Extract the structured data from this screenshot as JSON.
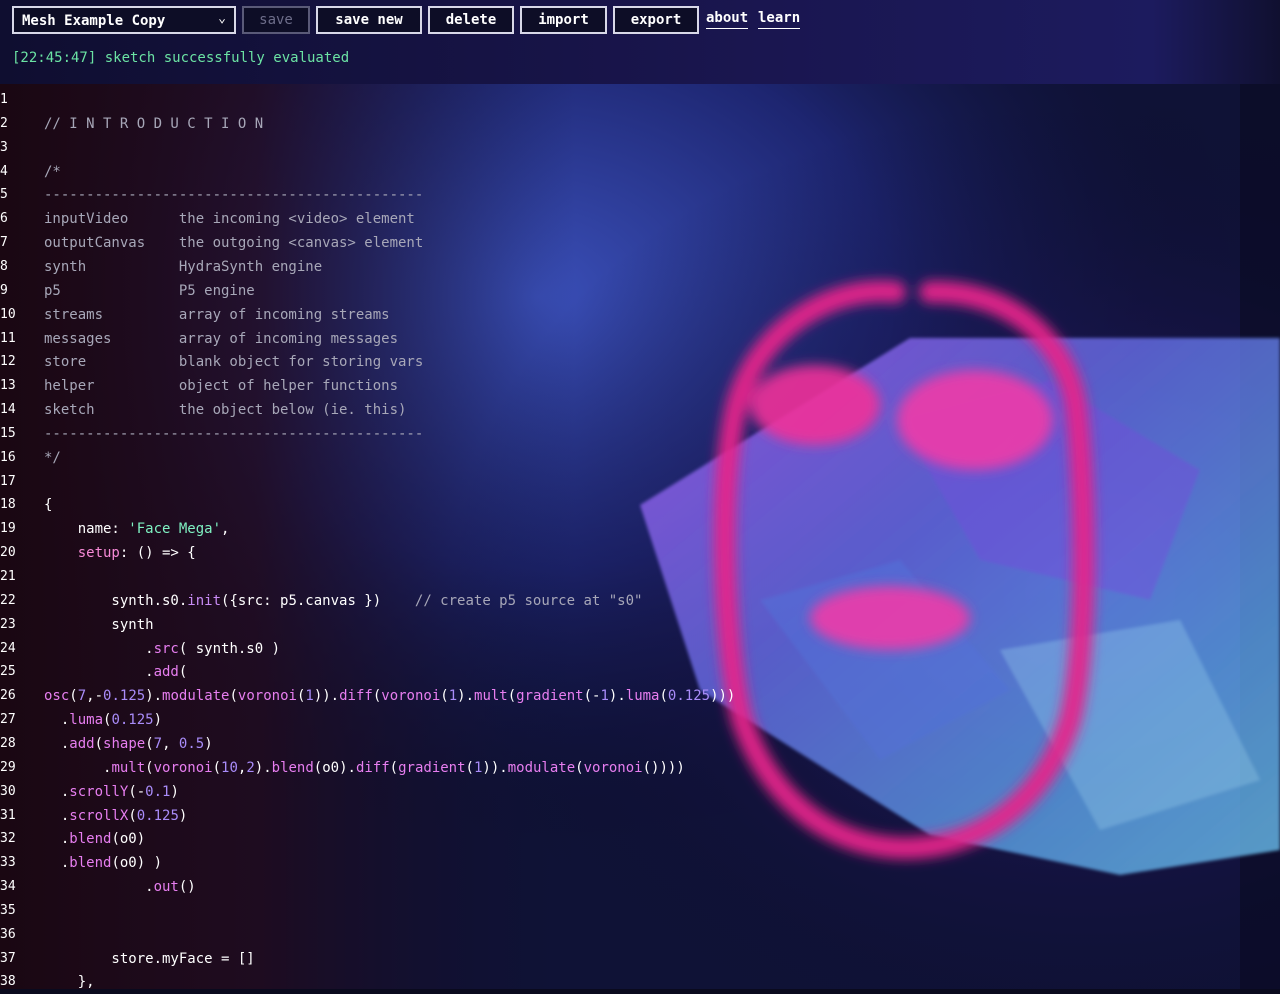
{
  "toolbar": {
    "sketch_select_value": "Mesh Example Copy",
    "save_label": "save",
    "save_new_label": "save new",
    "delete_label": "delete",
    "import_label": "import",
    "export_label": "export",
    "about_label": "about",
    "learn_label": "learn"
  },
  "status": {
    "text": "[22:45:47] sketch successfully evaluated"
  },
  "editor": {
    "lines": [
      [],
      [
        [
          "c",
          "// I N T R O D U C T I O N"
        ]
      ],
      [],
      [
        [
          "c",
          "/*"
        ]
      ],
      [
        [
          "c",
          "---------------------------------------------"
        ]
      ],
      [
        [
          "c",
          "inputVideo      the incoming <video> element"
        ]
      ],
      [
        [
          "c",
          "outputCanvas    the outgoing <canvas> element"
        ]
      ],
      [
        [
          "c",
          "synth           HydraSynth engine"
        ]
      ],
      [
        [
          "c",
          "p5              P5 engine"
        ]
      ],
      [
        [
          "c",
          "streams         array of incoming streams"
        ]
      ],
      [
        [
          "c",
          "messages        array of incoming messages"
        ]
      ],
      [
        [
          "c",
          "store           blank object for storing vars"
        ]
      ],
      [
        [
          "c",
          "helper          object of helper functions"
        ]
      ],
      [
        [
          "c",
          "sketch          the object below (ie. this)"
        ]
      ],
      [
        [
          "c",
          "---------------------------------------------"
        ]
      ],
      [
        [
          "c",
          "*/"
        ]
      ],
      [],
      [
        [
          "w",
          "{"
        ]
      ],
      [
        [
          "w",
          "    name: "
        ],
        [
          "s",
          "'Face Mega'"
        ],
        [
          "w",
          ","
        ]
      ],
      [
        [
          "k",
          "    setup"
        ],
        [
          "w",
          ": () => {"
        ]
      ],
      [],
      [
        [
          "w",
          "        synth.s0."
        ],
        [
          "f",
          "init"
        ],
        [
          "w",
          "({src: p5.canvas })    "
        ],
        [
          "c",
          "// create p5 source at \"s0\""
        ]
      ],
      [
        [
          "w",
          "        synth"
        ]
      ],
      [
        [
          "w",
          "            ."
        ],
        [
          "fn",
          "src"
        ],
        [
          "w",
          "( synth.s0 )"
        ]
      ],
      [
        [
          "w",
          "            ."
        ],
        [
          "fn",
          "add"
        ],
        [
          "w",
          "("
        ]
      ],
      [
        [
          "fn",
          "osc"
        ],
        [
          "w",
          "("
        ],
        [
          "n",
          "7"
        ],
        [
          "w",
          ",-"
        ],
        [
          "n",
          "0.125"
        ],
        [
          "w",
          ")."
        ],
        [
          "fn",
          "modulate"
        ],
        [
          "w",
          "("
        ],
        [
          "fn",
          "voronoi"
        ],
        [
          "w",
          "("
        ],
        [
          "n",
          "1"
        ],
        [
          "w",
          ")).",
          ""
        ],
        [
          "fn",
          "diff"
        ],
        [
          "w",
          "("
        ],
        [
          "fn",
          "voronoi"
        ],
        [
          "w",
          "("
        ],
        [
          "n",
          "1"
        ],
        [
          "w",
          ")."
        ],
        [
          "fn",
          "mult"
        ],
        [
          "w",
          "("
        ],
        [
          "fn",
          "gradient"
        ],
        [
          "w",
          "(-"
        ],
        [
          "n",
          "1"
        ],
        [
          "w",
          ")."
        ],
        [
          "fn",
          "luma"
        ],
        [
          "w",
          "("
        ],
        [
          "n",
          "0.125"
        ],
        [
          "w",
          ")))"
        ]
      ],
      [
        [
          "w",
          "  ."
        ],
        [
          "fn",
          "luma"
        ],
        [
          "w",
          "("
        ],
        [
          "n",
          "0.125"
        ],
        [
          "w",
          ")"
        ]
      ],
      [
        [
          "w",
          "  ."
        ],
        [
          "fn",
          "add"
        ],
        [
          "w",
          "("
        ],
        [
          "fn",
          "shape"
        ],
        [
          "w",
          "("
        ],
        [
          "n",
          "7"
        ],
        [
          "w",
          ", "
        ],
        [
          "n",
          "0.5"
        ],
        [
          "w",
          ")"
        ]
      ],
      [
        [
          "w",
          "       ."
        ],
        [
          "fn",
          "mult"
        ],
        [
          "w",
          "("
        ],
        [
          "fn",
          "voronoi"
        ],
        [
          "w",
          "("
        ],
        [
          "n",
          "10"
        ],
        [
          "w",
          ","
        ],
        [
          "n",
          "2"
        ],
        [
          "w",
          ")."
        ],
        [
          "fn",
          "blend"
        ],
        [
          "w",
          "(o0)."
        ],
        [
          "fn",
          "diff"
        ],
        [
          "w",
          "("
        ],
        [
          "fn",
          "gradient"
        ],
        [
          "w",
          "("
        ],
        [
          "n",
          "1"
        ],
        [
          "w",
          "))."
        ],
        [
          "fn",
          "modulate"
        ],
        [
          "w",
          "("
        ],
        [
          "fn",
          "voronoi"
        ],
        [
          "w",
          "())))"
        ]
      ],
      [
        [
          "w",
          "  ."
        ],
        [
          "fn",
          "scrollY"
        ],
        [
          "w",
          "(-"
        ],
        [
          "n",
          "0.1"
        ],
        [
          "w",
          ")"
        ]
      ],
      [
        [
          "w",
          "  ."
        ],
        [
          "fn",
          "scrollX"
        ],
        [
          "w",
          "("
        ],
        [
          "n",
          "0.125"
        ],
        [
          "w",
          ")"
        ]
      ],
      [
        [
          "w",
          "  ."
        ],
        [
          "fn",
          "blend"
        ],
        [
          "w",
          "(o0)"
        ]
      ],
      [
        [
          "w",
          "  ."
        ],
        [
          "fn",
          "blend"
        ],
        [
          "w",
          "(o0) )"
        ]
      ],
      [
        [
          "w",
          "            ."
        ],
        [
          "fn",
          "out"
        ],
        [
          "w",
          "()"
        ]
      ],
      [],
      [],
      [
        [
          "w",
          "        store.myFace = []"
        ]
      ],
      [
        [
          "w",
          "    },"
        ]
      ]
    ]
  }
}
